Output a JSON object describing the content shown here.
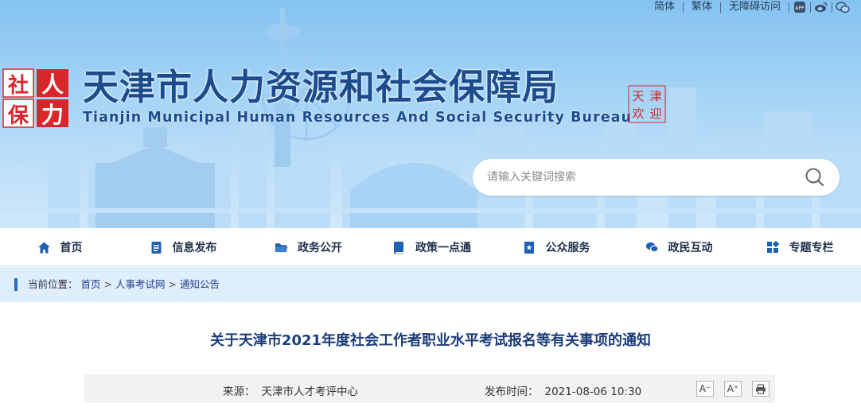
{
  "top_links": {
    "simplified": "简体",
    "traditional": "繁体",
    "accessibility": "无障碍访问",
    "app_icon_label": "APP"
  },
  "header": {
    "seal_chars": [
      "社",
      "人",
      "保",
      "力"
    ],
    "title": "天津市人力资源和社会保障局",
    "subtitle": "Tianjin Municipal Human Resources And Social Security Bureau",
    "minilogo_chars": [
      "天",
      "津",
      "欢",
      "迎"
    ]
  },
  "search": {
    "placeholder": "请输入关键词搜索"
  },
  "nav": {
    "items": [
      {
        "label": "首页",
        "icon": "home-icon"
      },
      {
        "label": "信息发布",
        "icon": "document-icon"
      },
      {
        "label": "政务公开",
        "icon": "folder-icon"
      },
      {
        "label": "政策一点通",
        "icon": "book-icon"
      },
      {
        "label": "公众服务",
        "icon": "bookmark-star-icon"
      },
      {
        "label": "政民互动",
        "icon": "chat-icon"
      },
      {
        "label": "专题专栏",
        "icon": "grid-icon"
      }
    ]
  },
  "breadcrumb": {
    "prefix": "当前位置：",
    "items": [
      "首页",
      "人事考试网",
      "通知公告"
    ],
    "separator": ">"
  },
  "article": {
    "title": "关于天津市2021年度社会工作者职业水平考试报名等有关事项的通知",
    "source_label": "来源：",
    "source_value": "天津市人才考评中心",
    "time_label": "发布时间：",
    "time_value": "2021-08-06 10:30",
    "font_decrease": "A⁻",
    "font_increase": "A⁺"
  },
  "colors": {
    "brand_blue": "#1c4c8d",
    "seal_red": "#d8262b",
    "nav_icon": "#1f5fb4",
    "breadcrumb_bg": "#dfeefc"
  }
}
